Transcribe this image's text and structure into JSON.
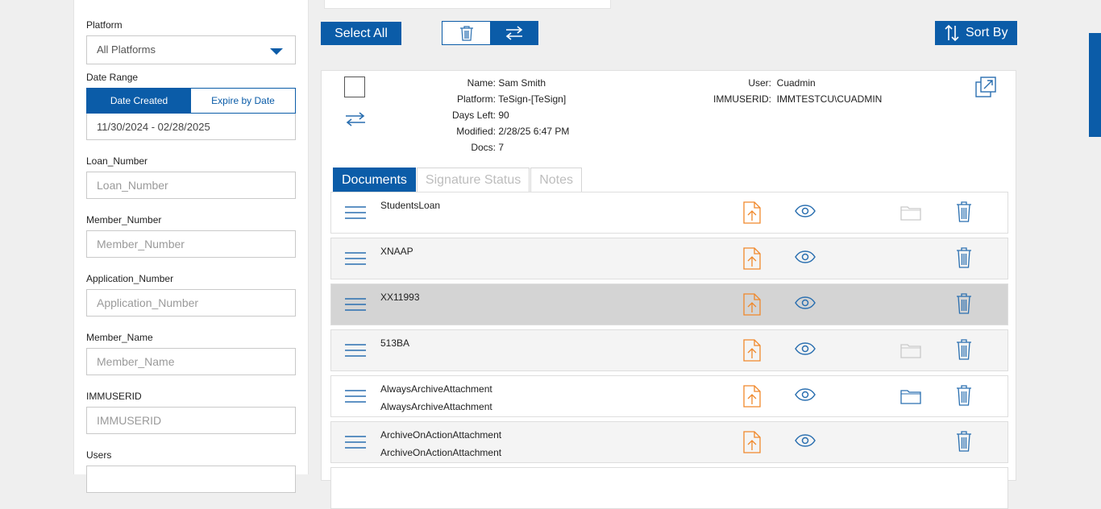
{
  "filters": {
    "platform": {
      "label": "Platform",
      "value": "All Platforms"
    },
    "date_range": {
      "label": "Date Range",
      "option_created": "Date Created",
      "option_expire": "Expire by Date",
      "value": "11/30/2024 - 02/28/2025"
    },
    "loan_number": {
      "label": "Loan_Number",
      "placeholder": "Loan_Number"
    },
    "member_number": {
      "label": "Member_Number",
      "placeholder": "Member_Number"
    },
    "application_number": {
      "label": "Application_Number",
      "placeholder": "Application_Number"
    },
    "member_name": {
      "label": "Member_Name",
      "placeholder": "Member_Name"
    },
    "immuserid": {
      "label": "IMMUSERID",
      "placeholder": "IMMUSERID"
    },
    "users": {
      "label": "Users"
    }
  },
  "toolbar": {
    "select_all": "Select All",
    "sort_by": "Sort By"
  },
  "package": {
    "name_label": "Name:",
    "name": "Sam Smith",
    "platform_label": "Platform:",
    "platform": "TeSign-[TeSign]",
    "days_left_label": "Days Left:",
    "days_left": "90",
    "modified_label": "Modified:",
    "modified": "2/28/25 6:47 PM",
    "docs_label": "Docs:",
    "docs": "7",
    "user_label": "User:",
    "user": "Cuadmin",
    "immuserid_label": "IMMUSERID:",
    "immuserid": "IMMTESTCU\\CUADMIN"
  },
  "tabs": [
    "Documents",
    "Signature Status",
    "Notes"
  ],
  "documents": [
    {
      "name": "StudentsLoan",
      "sub": "",
      "folder": "light"
    },
    {
      "name": "XNAAP",
      "sub": "",
      "folder": "none"
    },
    {
      "name": "XX11993",
      "sub": "",
      "folder": "none"
    },
    {
      "name": "513BA",
      "sub": "",
      "folder": "light"
    },
    {
      "name": "AlwaysArchiveAttachment",
      "sub": "AlwaysArchiveAttachment",
      "folder": "blue"
    },
    {
      "name": "ArchiveOnActionAttachment",
      "sub": "ArchiveOnActionAttachment",
      "folder": "none"
    }
  ],
  "colors": {
    "primary": "#0b5ca8",
    "upload": "#f0882a",
    "icon_blue": "#2a6fb0"
  }
}
